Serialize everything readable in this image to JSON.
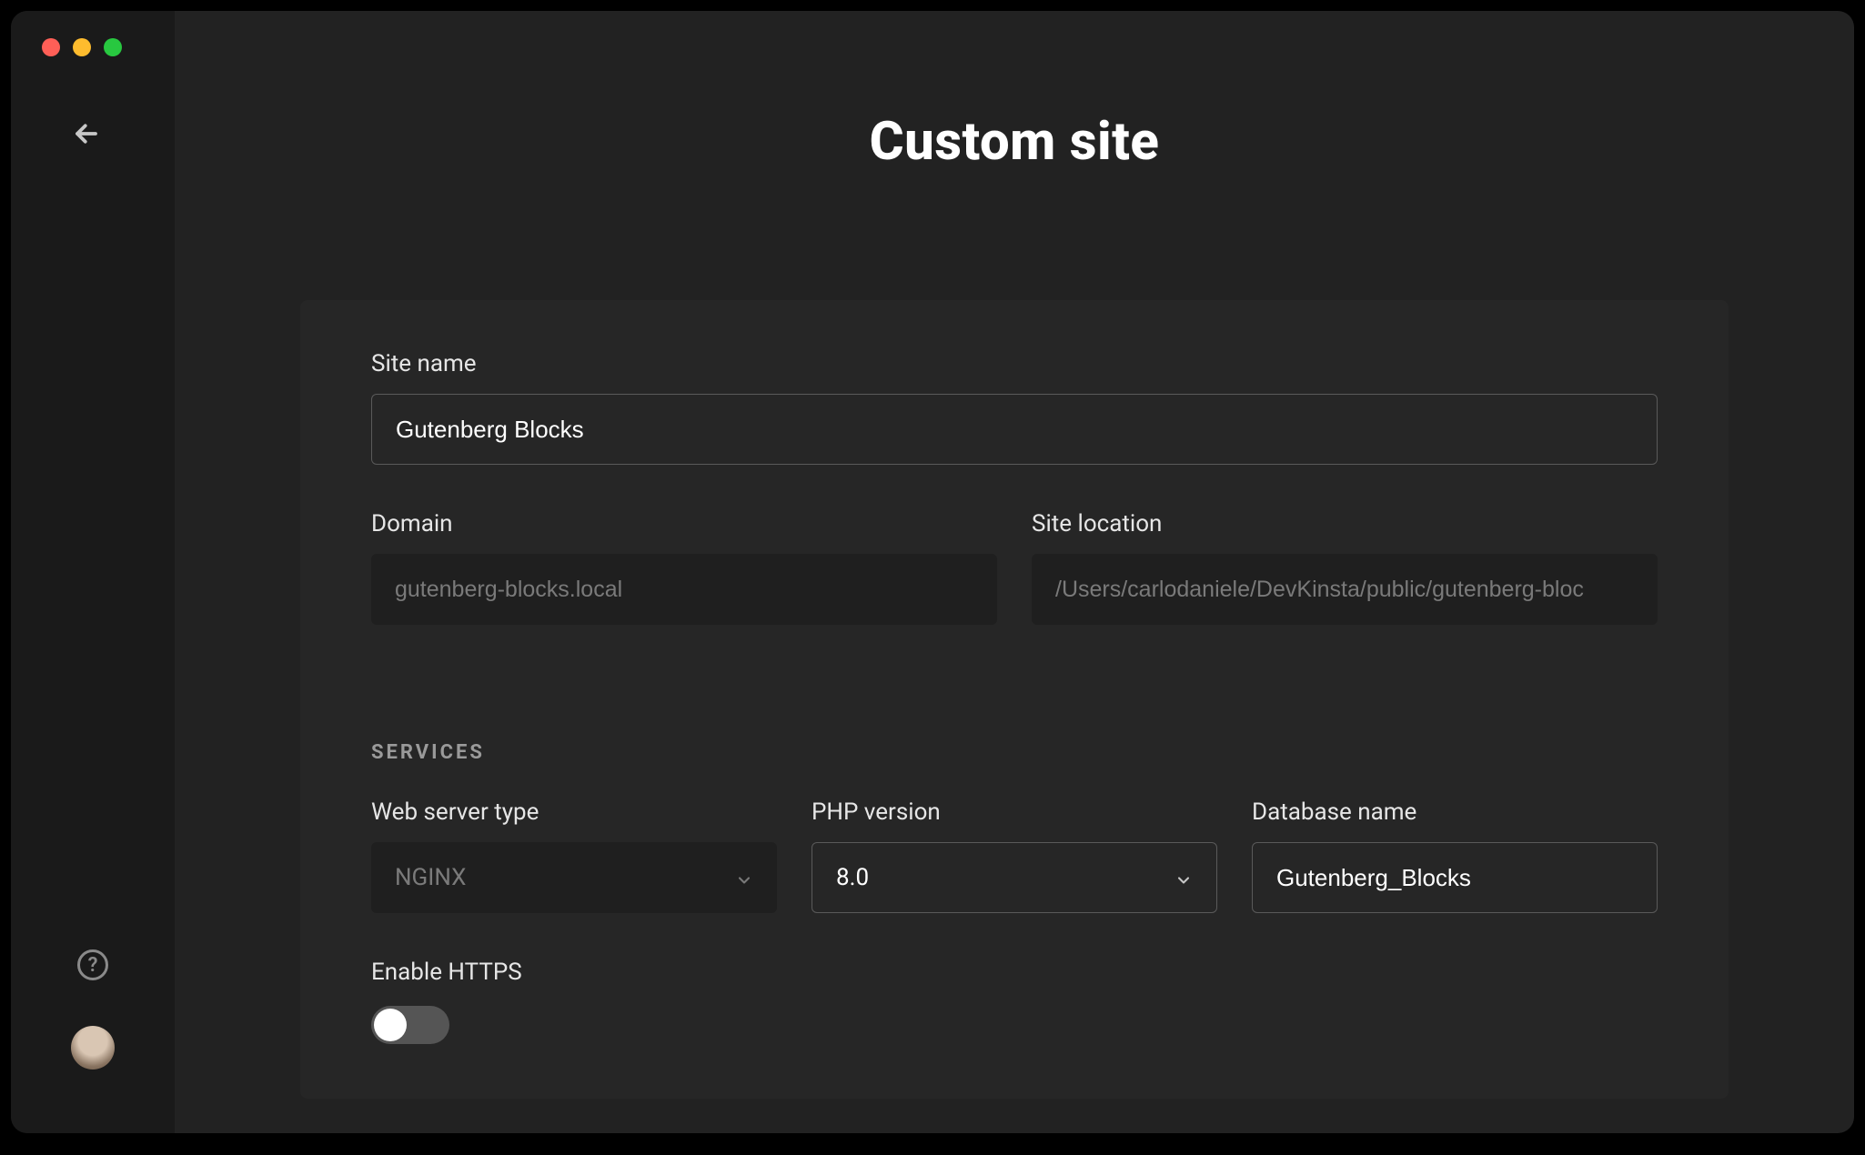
{
  "header": {
    "title": "Custom site"
  },
  "form": {
    "site_name_label": "Site name",
    "site_name_value": "Gutenberg Blocks",
    "domain_label": "Domain",
    "domain_value": "gutenberg-blocks.local",
    "site_location_label": "Site location",
    "site_location_value": "/Users/carlodaniele/DevKinsta/public/gutenberg-bloc",
    "services_heading": "SERVICES",
    "web_server_label": "Web server type",
    "web_server_value": "NGINX",
    "php_label": "PHP version",
    "php_value": "8.0",
    "db_label": "Database name",
    "db_value": "Gutenberg_Blocks",
    "https_label": "Enable HTTPS"
  }
}
